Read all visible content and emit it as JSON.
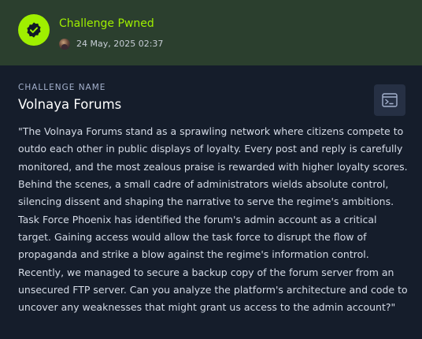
{
  "banner": {
    "status": "Challenge Pwned",
    "date": "24 May, 2025 02:37",
    "icon": "verified-badge-icon",
    "accent_color": "#9fef00"
  },
  "challenge": {
    "section_label": "CHALLENGE NAME",
    "name": "Volnaya Forums",
    "description": "\"The Volnaya Forums stand as a sprawling network where citizens compete to outdo each other in public displays of loyalty. Every post and reply is carefully monitored, and the most zealous praise is rewarded with higher loyalty scores. Behind the scenes, a small cadre of administrators wields absolute control, silencing dissent and shaping the narrative to serve the regime's ambitions. Task Force Phoenix has identified the forum's admin account as a critical target. Gaining access would allow the task force to disrupt the flow of propaganda and strike a blow against the regime's information control. Recently, we managed to secure a backup copy of the forum server from an unsecured FTP server. Can you analyze the platform's architecture and code to uncover any weaknesses that might grant us access to the admin account?\""
  },
  "actions": {
    "terminal_icon": "terminal-window-icon"
  }
}
